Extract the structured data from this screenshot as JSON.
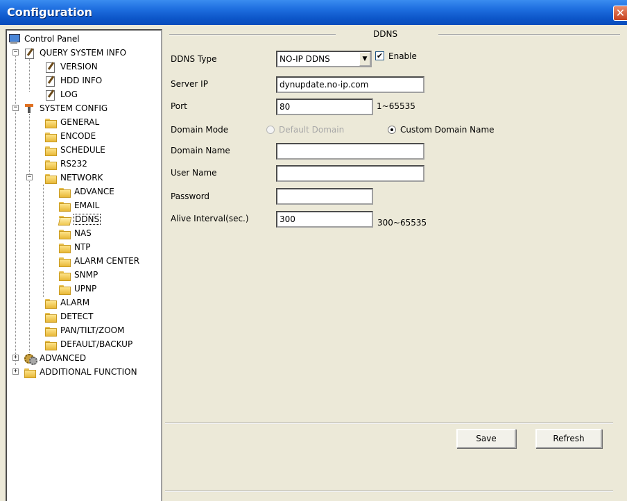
{
  "window": {
    "title": "Configuration",
    "close_glyph": "✕"
  },
  "tree": {
    "root": {
      "label": "Control Panel",
      "icon": "monitor-icon"
    },
    "query_system_info": {
      "label": "QUERY SYSTEM INFO",
      "expander": "−"
    },
    "version": {
      "label": "VERSION"
    },
    "hdd_info": {
      "label": "HDD INFO"
    },
    "log": {
      "label": "LOG"
    },
    "system_config": {
      "label": "SYSTEM CONFIG",
      "expander": "−"
    },
    "general": {
      "label": "GENERAL"
    },
    "encode": {
      "label": "ENCODE"
    },
    "schedule": {
      "label": "SCHEDULE"
    },
    "rs232": {
      "label": "RS232"
    },
    "network": {
      "label": "NETWORK",
      "expander": "−"
    },
    "advance": {
      "label": "ADVANCE"
    },
    "email": {
      "label": "EMAIL"
    },
    "ddns": {
      "label": "DDNS",
      "selected": true
    },
    "nas": {
      "label": "NAS"
    },
    "ntp": {
      "label": "NTP"
    },
    "alarm_center": {
      "label": "ALARM CENTER"
    },
    "snmp": {
      "label": "SNMP"
    },
    "upnp": {
      "label": "UPNP"
    },
    "alarm": {
      "label": "ALARM"
    },
    "detect": {
      "label": "DETECT"
    },
    "pan_tilt_zoom": {
      "label": "PAN/TILT/ZOOM"
    },
    "default_backup": {
      "label": "DEFAULT/BACKUP"
    },
    "advanced": {
      "label": "ADVANCED",
      "expander": "+"
    },
    "additional_function": {
      "label": "ADDITIONAL FUNCTION",
      "expander": "+"
    }
  },
  "ddns": {
    "group_title": "DDNS",
    "ddns_type_label": "DDNS Type",
    "ddns_type_value": "NO-IP DDNS",
    "enable_label": "Enable",
    "enable_checked": true,
    "check_glyph": "✔",
    "arrow_glyph": "▼",
    "server_ip_label": "Server IP",
    "server_ip_value": "dynupdate.no-ip.com",
    "port_label": "Port",
    "port_value": "80",
    "port_range": "1~65535",
    "domain_mode_label": "Domain Mode",
    "default_domain_label": "Default Domain",
    "custom_domain_label": "Custom Domain Name",
    "domain_mode_selected": "Custom Domain Name",
    "domain_name_label": "Domain Name",
    "domain_name_value": "",
    "user_name_label": "User Name",
    "user_name_value": "",
    "password_label": "Password",
    "password_value": "",
    "alive_interval_label": "Alive Interval(sec.)",
    "alive_interval_value": "300",
    "alive_interval_range": "300~65535"
  },
  "buttons": {
    "save_label": "Save",
    "refresh_label": "Refresh"
  }
}
